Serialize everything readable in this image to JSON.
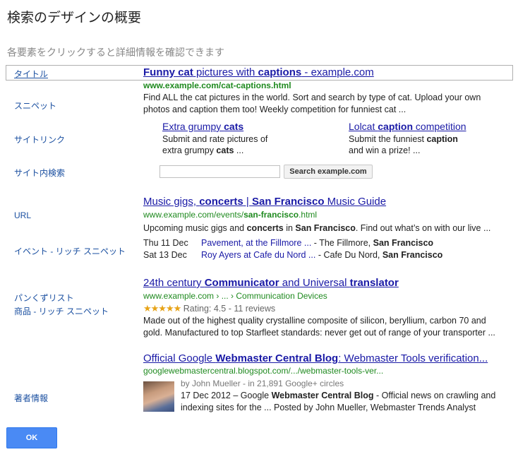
{
  "dialog": {
    "title": "検索のデザインの概要",
    "instruction": "各要素をクリックすると詳細情報を確認できます",
    "ok_label": "OK"
  },
  "labels": {
    "title": "タイトル",
    "snippet": "スニペット",
    "sitelinks": "サイトリンク",
    "sitesearch": "サイト内検索",
    "url": "URL",
    "events": "イベント - リッチ スニペット",
    "breadcrumbs": "パンくずリスト",
    "product": "商品 - リッチ スニペット",
    "author": "著者情報"
  },
  "result1": {
    "title_a": "Funny cat",
    "title_b": " pictures with ",
    "title_c": "captions",
    "title_d": " - example.com",
    "url": "www.example.com/cat-captions.html",
    "snippet_line1": "Find ALL the cat pictures in the world. Sort and search by type of cat. Upload your own",
    "snippet_line2": "photos and caption them too! Weekly competition for funniest cat ...",
    "sitelink1": {
      "title_a": "Extra grumpy ",
      "title_b": "cats",
      "desc_line1": "Submit and rate pictures of",
      "desc_line2a": "extra grumpy ",
      "desc_line2b": "cats",
      "desc_line2c": " ..."
    },
    "sitelink2": {
      "title_a": "Lolcat ",
      "title_b": "caption",
      "title_c": " competition",
      "desc_line1a": "Submit the funniest ",
      "desc_line1b": "caption",
      "desc_line2": "and win a prize! ..."
    },
    "search_button": "Search example.com",
    "search_value": ""
  },
  "result2": {
    "title_a": "Music gigs, ",
    "title_b": "concerts",
    "title_c": " | ",
    "title_d": "San Francisco",
    "title_e": " Music Guide",
    "url_a": "www.example.com/events/",
    "url_b": "san-francisco",
    "url_c": ".html",
    "snippet_a": "Upcoming music gigs and ",
    "snippet_b": "concerts",
    "snippet_c": " in ",
    "snippet_d": "San Francisco",
    "snippet_e": ". Find out what’s on with our live ...",
    "events": [
      {
        "date": "Thu 11 Dec",
        "link": "Pavement, at the Fillmore ...",
        "venue": " - The Fillmore, ",
        "city": "San Francisco"
      },
      {
        "date": "Sat 13 Dec",
        "link": "Roy Ayers at Cafe du Nord ...",
        "venue": " - Cafe Du Nord, ",
        "city": "San Francisco"
      }
    ]
  },
  "result3": {
    "title_a": "24th century ",
    "title_b": "Communicator",
    "title_c": " and Universal ",
    "title_d": "translator",
    "breadcrumb_a": "www.example.com",
    "breadcrumb_b": " › ... › ",
    "breadcrumb_c": "Communication Devices",
    "stars": "★★★★★",
    "rating_value": 4.5,
    "rating_text": "Rating: 4.5 - 11 reviews",
    "snippet_line1": "Made out of the highest quality crystalline composite of silicon, beryllium, carbon 70 and",
    "snippet_line2": "gold. Manufactured to top Starfleet standards: never get out of range of your transporter ..."
  },
  "result4": {
    "title_a": "Official Google ",
    "title_b": "Webmaster Central Blog",
    "title_c": ": Webmaster Tools verification...",
    "url": "googlewebmastercentral.blogspot.com/.../webmaster-tools-ver...",
    "byline": "by John Mueller - in 21,891 Google+ circles",
    "snippet_line1a": "17 Dec 2012 – Google ",
    "snippet_line1b": "Webmaster Central Blog",
    "snippet_line1c": " - Official news on crawling and",
    "snippet_line2": "indexing  sites for the ... Posted by John Mueller, Webmaster Trends Analyst"
  },
  "colors": {
    "link": "#1a1aa6",
    "url": "#1f8a1f",
    "label": "#1a4fa0",
    "ok_button": "#4a8af4",
    "stars": "#e7a317"
  }
}
